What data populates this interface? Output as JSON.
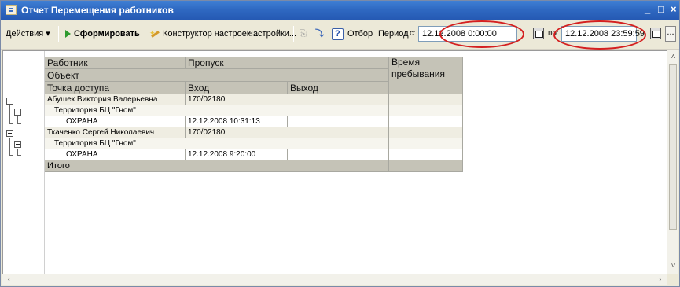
{
  "window": {
    "title": "Отчет  Перемещения работников",
    "min_label": "_",
    "max_label": "□",
    "close_label": "×"
  },
  "toolbar": {
    "actions_label": "Действия",
    "generate_label": "Сформировать",
    "designer_label": "Конструктор настроек...",
    "settings_label": "Настройки...",
    "filter_label": "Отбор",
    "period_label": "Период",
    "period_from_suffix": "с:",
    "period_from": "12.12.2008  0:00:00",
    "period_to_label": "по:",
    "period_to": "12.12.2008 23:59:59",
    "more_label": "..."
  },
  "table": {
    "headers": {
      "employee": "Работник",
      "pass": "Пропуск",
      "time": "Время пребывания",
      "object": "Объект",
      "access_point": "Точка доступа",
      "entry": "Вход",
      "exit": "Выход"
    },
    "groups": [
      {
        "employee": "Абушек Виктория Валерьевна",
        "pass": "170/02180",
        "object": "Территория БЦ \"Гном\"",
        "point": "ОХРАНА",
        "entry": "12.12.2008 10:31:13",
        "exit": ""
      },
      {
        "employee": "Ткаченко Сергей Николаевич",
        "pass": "170/02180",
        "object": "Территория БЦ \"Гном\"",
        "point": "ОХРАНА",
        "entry": "12.12.2008 9:20:00",
        "exit": ""
      }
    ],
    "total_label": "Итого"
  },
  "colors": {
    "highlight_circle": "#d42020",
    "header_bg": "#c5c3b7",
    "titlebar": "#2f69c2"
  }
}
